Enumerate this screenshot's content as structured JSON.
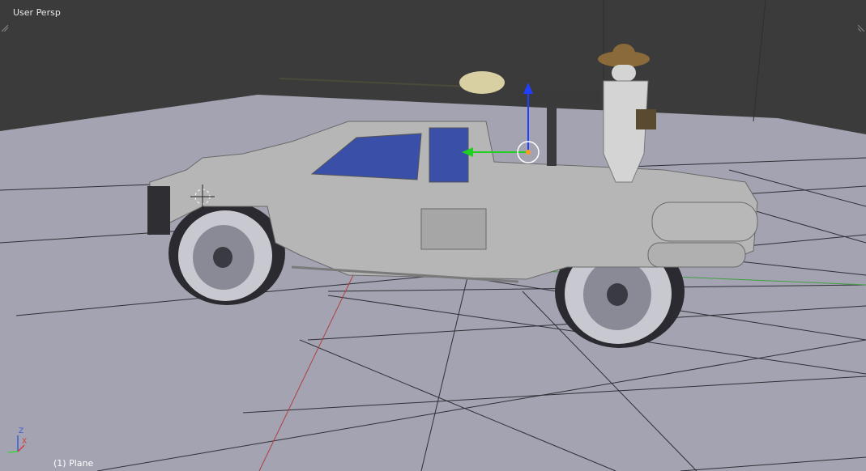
{
  "viewport": {
    "title": "User Persp",
    "active_object": "(1) Plane"
  },
  "axis_widget": {
    "z_label": "Z",
    "x_label": "X",
    "z_color": "#3b5bd6",
    "x_color": "#d63b3b",
    "y_color": "#3bd63b"
  },
  "manipulator": {
    "z_arrow_color": "#2040ff",
    "y_arrow_color": "#20d020",
    "ring_color": "#ffffff",
    "pivot_color": "#ff9a20"
  },
  "scene": {
    "background_color": "#3b3b3b",
    "floor_color": "#a3a3b2",
    "grid_color": "#2f2f36",
    "x_axis_line_color": "#b04040",
    "y_axis_line_color": "#40a040",
    "model_color": "#b6b6b6",
    "glass_color": "#3a4fa8",
    "hat_color": "#8a6a3a",
    "icons": [
      "vehicle-model",
      "gunner-figure",
      "transform-manipulator"
    ]
  }
}
